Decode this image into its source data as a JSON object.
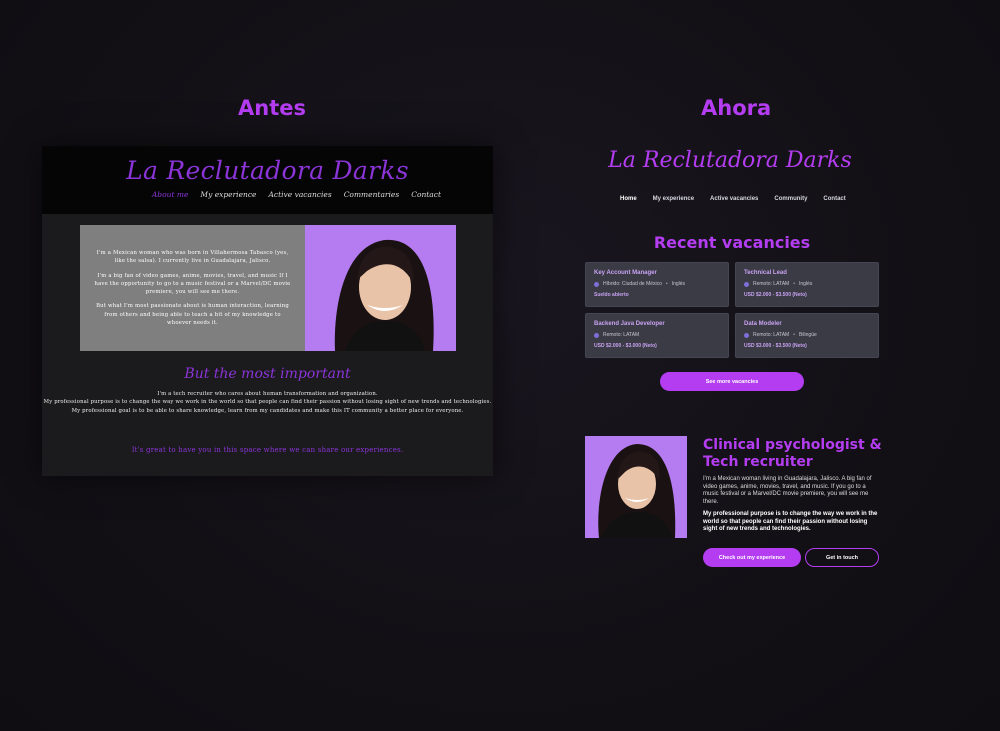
{
  "headings": {
    "before": "Antes",
    "after": "Ahora"
  },
  "old_site": {
    "logo": "La Reclutadora Darks",
    "nav": [
      "About me",
      "My experience",
      "Active vacancies",
      "Commentaries",
      "Contact"
    ],
    "hero_paragraphs": [
      "I'm a Mexican woman who was born in Villahermosa Tabasco (yes, like the salsa). I currently live in Guadalajara, Jalisco.",
      "I'm a big fan of video games, anime, movies, travel, and music If I have the opportunity to go to a music festival or a Marvel/DC movie premiere, you will see me there.",
      "But what I'm most passionate about is human interaction, learning from others and being able to teach a bit of my knowledge to whoever needs it."
    ],
    "subtitle": "But the most important",
    "body_lines": [
      "I'm a tech recruiter who cares about human transformation and organization.",
      "My professional purpose is to change the way we work in the world so that people can find their passion without losing sight of new trends and technologies.",
      "My professional goal is to be able to share knowledge, learn from my candidates and make this IT community a better place for everyone."
    ],
    "footer": "It's great to have you in this space where we can share our experiences."
  },
  "new_site": {
    "logo": "La Reclutadora Darks",
    "nav": [
      "Home",
      "My experience",
      "Active vacancies",
      "Community",
      "Contact"
    ],
    "vacancies_title": "Recent vacancies",
    "vacancies": [
      {
        "title": "Key Account Manager",
        "location": "Híbrido: Ciudad de México",
        "language": "Inglés",
        "salary": "Sueldo abierto"
      },
      {
        "title": "Technical Lead",
        "location": "Remoto: LATAM",
        "language": "Inglés",
        "salary": "USD $2.000 - $3.500 (Neto)"
      },
      {
        "title": "Backend Java Developer",
        "location": "Remoto: LATAM",
        "language": "",
        "salary": "USD $2.000 - $3.000 (Neto)"
      },
      {
        "title": "Data Modeler",
        "location": "Remoto: LATAM",
        "language": "Bilingüe",
        "salary": "USD $3.000 - $3.500 (Neto)"
      }
    ],
    "see_more": "See more vacancies",
    "about_title": "Clinical psychologist & Tech recruiter",
    "about_p1": "I'm a Mexican woman living in Guadalajara, Jalisco. A big fan of video games, anime, movies, travel, and music. If you go to a music festival or a Marvel/DC movie premiere, you will see me there.",
    "about_p2": "My professional purpose is to change the way we work in the world so that people can find their passion without losing sight of new trends and technologies.",
    "btn_experience": "Check out my experience",
    "btn_contact": "Get in touch"
  },
  "colors": {
    "accent": "#b43df2",
    "card": "#3a3b45",
    "photo_bg": "#b57cf2"
  }
}
